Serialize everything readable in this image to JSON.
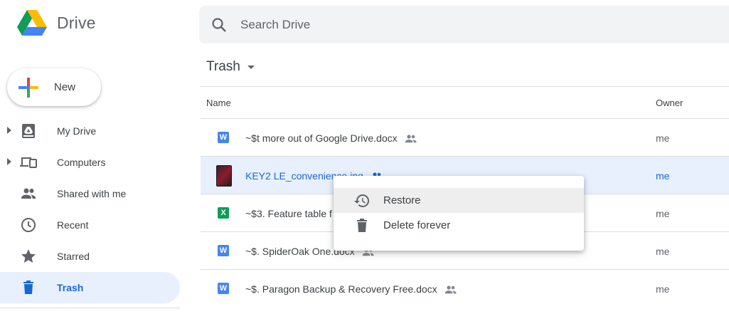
{
  "app": {
    "name": "Drive"
  },
  "search": {
    "placeholder": "Search Drive"
  },
  "new_button": {
    "label": "New"
  },
  "sidebar": {
    "items": [
      {
        "label": "My Drive",
        "icon": "my-drive-icon",
        "expandable": true
      },
      {
        "label": "Computers",
        "icon": "computers-icon",
        "expandable": true
      },
      {
        "label": "Shared with me",
        "icon": "shared-people-icon"
      },
      {
        "label": "Recent",
        "icon": "clock-icon"
      },
      {
        "label": "Starred",
        "icon": "star-icon"
      },
      {
        "label": "Trash",
        "icon": "trash-icon",
        "active": true
      }
    ]
  },
  "folder": {
    "title": "Trash"
  },
  "table": {
    "columns": [
      "Name",
      "Owner"
    ],
    "rows": [
      {
        "name": "~$t more out of Google Drive.docx",
        "type": "W",
        "color": "#4285f4",
        "owner": "me",
        "shared": true
      },
      {
        "name": "KEY2 LE_convenience.jpg",
        "type": "image",
        "owner": "me",
        "shared": true,
        "selected": true
      },
      {
        "name": "~$3. Feature table f",
        "type": "X",
        "color": "#0f9d58",
        "owner": "me"
      },
      {
        "name": "~$. SpiderOak One.docx",
        "type": "W",
        "color": "#4285f4",
        "owner": "me",
        "shared": true
      },
      {
        "name": "~$. Paragon Backup & Recovery Free.docx",
        "type": "W",
        "color": "#4285f4",
        "owner": "me",
        "shared": true
      }
    ]
  },
  "context_menu": {
    "items": [
      {
        "label": "Restore",
        "icon": "restore-history-icon"
      },
      {
        "label": "Delete forever",
        "icon": "trash-icon"
      }
    ]
  },
  "colors": {
    "accent": "#1967d2",
    "selected_bg": "#e8f0fe",
    "search_bg": "#f1f3f4"
  }
}
